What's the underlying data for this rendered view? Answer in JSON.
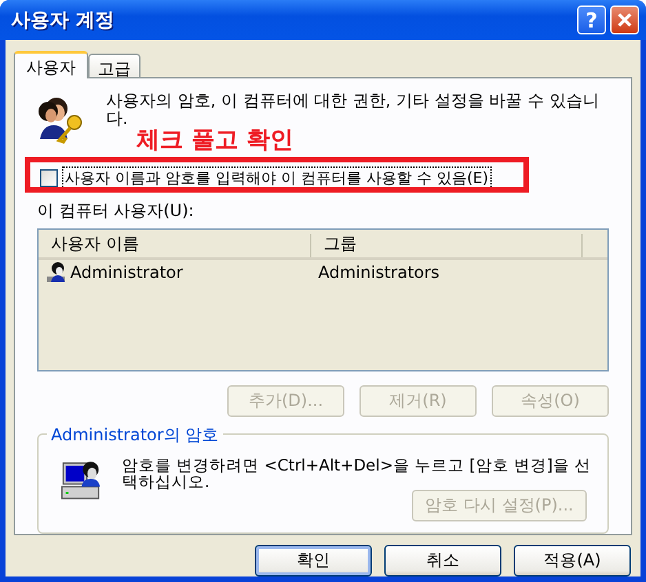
{
  "window": {
    "title": "사용자 계정",
    "help_button": "?"
  },
  "tabs": [
    {
      "label": "사용자",
      "selected": true
    },
    {
      "label": "고급",
      "selected": false
    }
  ],
  "intro": "사용자의 암호, 이 컴퓨터에 대한  권한, 기타 설정을 바꿀 수 있습니다.",
  "annotation": {
    "text": "체크 풀고 확인"
  },
  "checkbox": {
    "label": "사용자 이름과 암호를 입력해야 이 컴퓨터를 사용할 수 있음(E)",
    "checked": false
  },
  "users_label": "이 컴퓨터 사용자(U):",
  "table": {
    "columns": [
      "사용자 이름",
      "그룹"
    ],
    "rows": [
      {
        "cells": [
          "Administrator",
          "Administrators"
        ],
        "selected": false
      }
    ]
  },
  "list_buttons": [
    {
      "label": "추가(D)...",
      "disabled": true
    },
    {
      "label": "제거(R)",
      "disabled": true
    },
    {
      "label": "속성(O)",
      "disabled": true
    }
  ],
  "password_group": {
    "title": "Administrator의 암호",
    "text": "암호를 변경하려면 <Ctrl+Alt+Del>을 누르고 [암호 변경]을 선택하십시오.",
    "button": {
      "label": "암호 다시 설정(P)...",
      "disabled": true
    }
  },
  "buttons": [
    {
      "label": "확인",
      "default": true
    },
    {
      "label": "취소",
      "default": false
    },
    {
      "label": "적용(A)",
      "default": false
    }
  ]
}
